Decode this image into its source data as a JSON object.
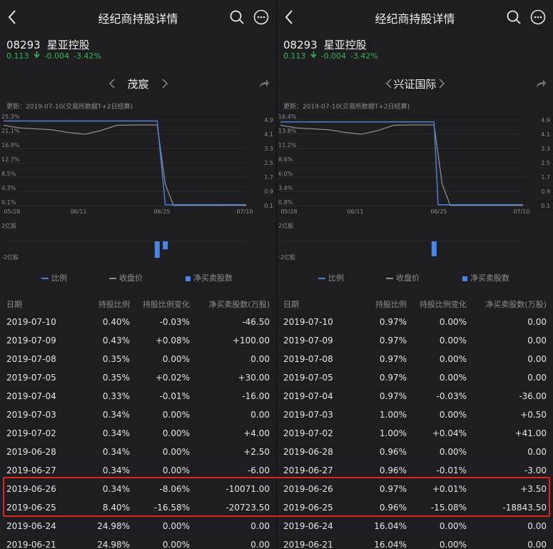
{
  "theme": {
    "background": "#1e1e20",
    "text": "#e6e6e6",
    "muted": "#8e8e93",
    "down_green": "#2fb755",
    "ratio_line_blue": "#4a7fd4",
    "price_line_gray": "#8e8e8e",
    "net_bar_blue": "#4a86e8",
    "highlight_red": "#e0241b"
  },
  "header": {
    "title": "经纪商持股详情",
    "back_icon": "chevron-left-icon",
    "search_icon": "search-icon",
    "more_icon": "more-dots-icon"
  },
  "stock": {
    "code": "08293",
    "name": "星亚控股",
    "price": "0.113",
    "change": "-0.004",
    "change_pct": "-3.42%"
  },
  "legend": {
    "ratio": "比例",
    "close": "收盘价",
    "net": "净买卖股数"
  },
  "columns": [
    "日期",
    "持股比例",
    "持股比例变化",
    "净买卖股数(万股)"
  ],
  "highlight": {
    "rows": [
      "2019-06-26",
      "2019-06-25"
    ]
  },
  "panels": [
    {
      "broker": "茂宸",
      "updated": "更新：2019-07-10(交易所数据T+2日结算)",
      "chart_data": {
        "type": "line",
        "x_ticks": [
          "05/28",
          "06/11",
          "06/25",
          "07/10"
        ],
        "y_left_ticks": [
          "25.3%",
          "21.1%",
          "16.9%",
          "12.7%",
          "8.5%",
          "4.3%",
          "0.1%"
        ],
        "y_right_ticks": [
          "4.9",
          "4.1",
          "3.3",
          "2.5",
          "1.7",
          "0.9",
          "0.1"
        ],
        "ylim_left": [
          0.1,
          25.3
        ],
        "ylim_right": [
          0.1,
          4.9
        ],
        "series": [
          {
            "name": "比例",
            "x": [
              0,
              11,
              19,
              20,
              30
            ],
            "values": [
              24.98,
              24.98,
              24.98,
              0.34,
              0.4
            ]
          },
          {
            "name": "收盘价",
            "x": [
              0,
              2,
              4,
              6,
              8,
              10,
              12,
              14,
              16,
              18,
              19,
              20,
              21,
              25,
              30
            ],
            "values": [
              4.6,
              4.45,
              4.4,
              4.35,
              4.2,
              4.1,
              4.3,
              4.6,
              4.62,
              4.62,
              4.62,
              1.3,
              0.113,
              0.113,
              0.113
            ]
          }
        ],
        "net_ticks": [
          "2亿股",
          "-2亿股"
        ],
        "net_range": [
          -2.5,
          2.5
        ],
        "net_bars": {
          "x": [
            19,
            20
          ],
          "values": [
            -2.07,
            -1.01
          ]
        }
      },
      "rows": [
        [
          "2019-07-10",
          "0.40%",
          "-0.03%",
          "-46.50"
        ],
        [
          "2019-07-09",
          "0.43%",
          "+0.08%",
          "+100.00"
        ],
        [
          "2019-07-08",
          "0.35%",
          "0.00%",
          "0.00"
        ],
        [
          "2019-07-05",
          "0.35%",
          "+0.02%",
          "+30.00"
        ],
        [
          "2019-07-04",
          "0.33%",
          "-0.01%",
          "-16.00"
        ],
        [
          "2019-07-03",
          "0.34%",
          "0.00%",
          "0.00"
        ],
        [
          "2019-07-02",
          "0.34%",
          "0.00%",
          "+4.00"
        ],
        [
          "2019-06-28",
          "0.34%",
          "0.00%",
          "+2.50"
        ],
        [
          "2019-06-27",
          "0.34%",
          "0.00%",
          "-6.00"
        ],
        [
          "2019-06-26",
          "0.34%",
          "-8.06%",
          "-10071.00"
        ],
        [
          "2019-06-25",
          "8.40%",
          "-16.58%",
          "-20723.50"
        ],
        [
          "2019-06-24",
          "24.98%",
          "0.00%",
          "0.00"
        ],
        [
          "2019-06-21",
          "24.98%",
          "0.00%",
          "0.00"
        ]
      ]
    },
    {
      "broker": "兴证国际",
      "updated": "更新：2019-07-10(交易所数据T+2日结算)",
      "chart_data": {
        "type": "line",
        "x_ticks": [
          "05/28",
          "06/11",
          "06/25",
          "07/10"
        ],
        "y_left_ticks": [
          "16.4%",
          "13.8%",
          "11.2%",
          "8.6%",
          "6.0%",
          "3.4%",
          "0.8%"
        ],
        "y_right_ticks": [
          "4.9",
          "4.1",
          "3.3",
          "2.5",
          "1.7",
          "0.9",
          "0.1"
        ],
        "ylim_left": [
          0.8,
          16.4
        ],
        "ylim_right": [
          0.1,
          4.9
        ],
        "series": [
          {
            "name": "比例",
            "x": [
              0,
              11,
              19,
              19.5,
              30
            ],
            "values": [
              16.04,
              16.04,
              16.04,
              0.96,
              0.97
            ]
          },
          {
            "name": "收盘价",
            "x": [
              0,
              2,
              4,
              6,
              8,
              10,
              12,
              14,
              16,
              18,
              19,
              20,
              21,
              25,
              30
            ],
            "values": [
              4.6,
              4.45,
              4.4,
              4.35,
              4.2,
              4.1,
              4.3,
              4.6,
              4.62,
              4.62,
              4.62,
              1.3,
              0.113,
              0.113,
              0.113
            ]
          }
        ],
        "net_ticks": [
          "2亿股",
          "-2亿股"
        ],
        "net_range": [
          -2.5,
          2.5
        ],
        "net_bars": {
          "x": [
            19
          ],
          "values": [
            -1.88
          ]
        }
      },
      "rows": [
        [
          "2019-07-10",
          "0.97%",
          "0.00%",
          "0.00"
        ],
        [
          "2019-07-09",
          "0.97%",
          "0.00%",
          "0.00"
        ],
        [
          "2019-07-08",
          "0.97%",
          "0.00%",
          "0.00"
        ],
        [
          "2019-07-05",
          "0.97%",
          "0.00%",
          "0.00"
        ],
        [
          "2019-07-04",
          "0.97%",
          "-0.03%",
          "-36.00"
        ],
        [
          "2019-07-03",
          "1.00%",
          "0.00%",
          "+0.50"
        ],
        [
          "2019-07-02",
          "1.00%",
          "+0.04%",
          "+41.00"
        ],
        [
          "2019-06-28",
          "0.96%",
          "0.00%",
          "0.00"
        ],
        [
          "2019-06-27",
          "0.96%",
          "-0.01%",
          "-3.00"
        ],
        [
          "2019-06-26",
          "0.97%",
          "+0.01%",
          "+3.50"
        ],
        [
          "2019-06-25",
          "0.96%",
          "-15.08%",
          "-18843.50"
        ],
        [
          "2019-06-24",
          "16.04%",
          "0.00%",
          "0.00"
        ],
        [
          "2019-06-21",
          "16.04%",
          "0.00%",
          "0.00"
        ]
      ]
    }
  ]
}
